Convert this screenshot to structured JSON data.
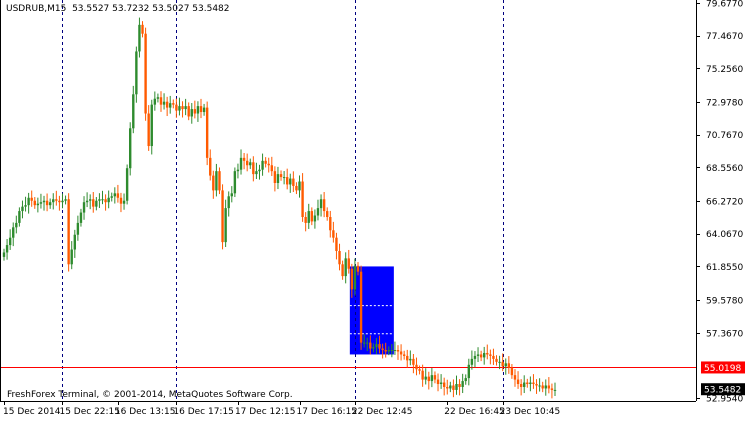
{
  "header": {
    "symbol": "USDRUB,M15",
    "ohlc": "53.5527 53.7232 53.5027 53.5482"
  },
  "footer": {
    "copyright": "FreshForex Terminal, © 2001-2014, MetaQuotes Software Corp."
  },
  "colors": {
    "bull": "#2e8b2e",
    "bear": "#ff5a00",
    "box": "#0000ff",
    "level_line": "#ff0000",
    "current_tag": "#000000"
  },
  "chart_data": {
    "type": "candlestick",
    "title": "",
    "y_ticks": [
      "79.6770",
      "77.4670",
      "75.2560",
      "72.9780",
      "70.7670",
      "68.5560",
      "66.2720",
      "64.0670",
      "61.8550",
      "59.5780",
      "57.3670",
      "55.0198",
      "53.5482",
      "52.9540"
    ],
    "ylim": [
      52.954,
      79.677
    ],
    "x_ticks": [
      "15 Dec 2014",
      "15 Dec 22:15",
      "16 Dec 13:15",
      "16 Dec 17:15",
      "17 Dec 12:15",
      "17 Dec 16:15",
      "22 Dec 12:45",
      "22 Dec 16:45",
      "23 Dec 10:45"
    ],
    "session_separators": [
      "15 Dec 22:15",
      "16 Dec 17:15",
      "17 Dec 16:15",
      "22 Dec 16:45"
    ],
    "level_line": {
      "value": 55.0198,
      "label": "55.0198"
    },
    "current_price": {
      "value": 53.5482,
      "label": "53.5482"
    },
    "highlight_box": {
      "y_top": 61.855,
      "y_bottom": 55.9
    },
    "series": [
      {
        "name": "USDRUB,M15",
        "close": [
          62.8,
          63.3,
          63.8,
          64.5,
          64.8,
          65.6,
          65.9,
          66.0,
          66.5,
          66.3,
          66.0,
          66.1,
          66.2,
          66.3,
          66.0,
          66.2,
          66.4,
          66.3,
          66.2,
          66.3,
          66.4,
          62.0,
          63.0,
          64.0,
          64.8,
          65.5,
          66.2,
          66.3,
          66.4,
          65.9,
          66.3,
          66.4,
          66.4,
          66.2,
          66.5,
          66.6,
          66.8,
          66.5,
          66.1,
          66.3,
          68.5,
          71.2,
          73.5,
          76.4,
          78.2,
          77.6,
          72.2,
          70.0,
          72.8,
          73.2,
          73.3,
          72.8,
          73.0,
          72.6,
          72.9,
          72.8,
          72.4,
          72.7,
          72.5,
          72.7,
          72.0,
          72.5,
          72.2,
          72.7,
          72.3,
          72.6,
          69.2,
          68.0,
          67.0,
          68.3,
          67.0,
          63.5,
          65.8,
          66.6,
          66.8,
          68.3,
          68.4,
          69.2,
          69.0,
          68.7,
          68.9,
          68.1,
          68.3,
          68.4,
          69.0,
          68.8,
          68.7,
          68.3,
          67.5,
          68.1,
          67.9,
          67.9,
          67.4,
          67.8,
          67.3,
          67.0,
          67.6,
          65.2,
          64.8,
          65.6,
          64.9,
          65.3,
          65.8,
          66.4,
          65.6,
          65.2,
          64.3,
          63.8,
          62.9,
          62.0,
          61.2,
          62.4,
          61.7,
          60.3,
          61.9,
          61.5,
          56.7,
          56.7,
          56.7,
          56.3,
          56.4,
          56.6,
          56.3,
          56.2,
          56.1,
          56.2,
          56.2,
          56.2,
          56.1,
          55.9,
          55.8,
          55.5,
          55.6,
          55.2,
          54.9,
          54.8,
          54.2,
          54.4,
          54.1,
          54.5,
          54.2,
          53.9,
          54.0,
          53.7,
          53.6,
          53.8,
          53.5,
          53.9,
          53.7,
          54.1,
          54.3,
          55.2,
          55.6,
          55.8,
          55.9,
          55.7,
          56.0,
          55.9,
          55.8,
          55.6,
          55.4,
          55.4,
          55.1,
          55.3,
          55.0,
          54.5,
          54.2,
          53.9,
          53.7,
          54.0,
          53.9,
          54.0,
          53.9,
          53.8,
          53.8,
          53.6,
          53.8,
          53.6,
          53.5,
          53.5
        ]
      }
    ]
  }
}
